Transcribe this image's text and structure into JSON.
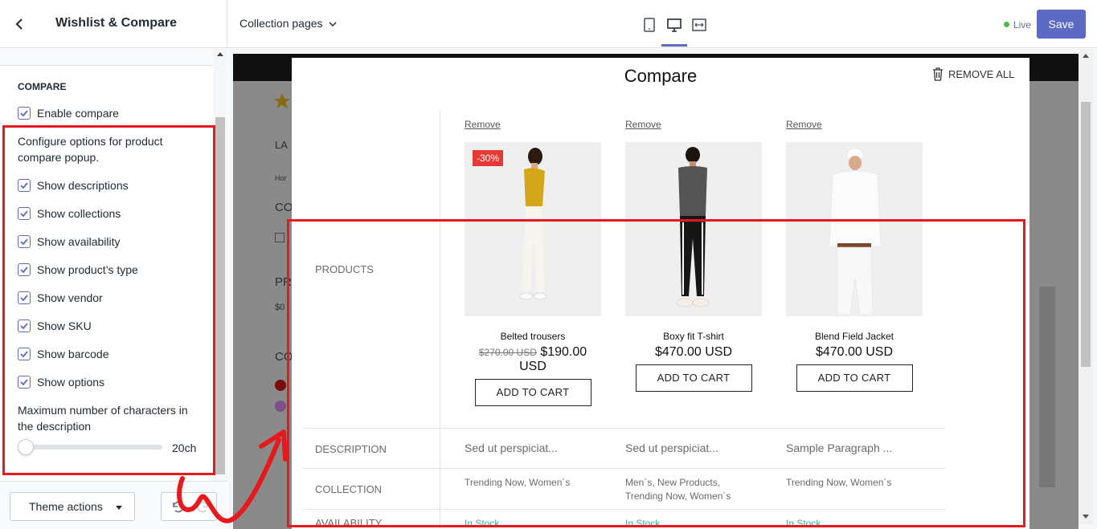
{
  "header": {
    "title": "Wishlist & Compare",
    "page_selector": "Collection pages",
    "status": "Live",
    "save_label": "Save",
    "accent_color": "#5c6ac4",
    "live_color": "#50b83c"
  },
  "sidebar": {
    "section_heading": "COMPARE",
    "enable_compare": {
      "label": "Enable compare",
      "checked": true
    },
    "configure_text": "Configure options for product compare popup.",
    "options": [
      {
        "label": "Show descriptions",
        "checked": true
      },
      {
        "label": "Show collections",
        "checked": true
      },
      {
        "label": "Show availability",
        "checked": true
      },
      {
        "label": "Show product’s type",
        "checked": true
      },
      {
        "label": "Show vendor",
        "checked": true
      },
      {
        "label": "Show SKU",
        "checked": true
      },
      {
        "label": "Show barcode",
        "checked": true
      },
      {
        "label": "Show options",
        "checked": true
      }
    ],
    "max_chars_label": "Maximum number of characters in the description",
    "max_chars_value": "20ch",
    "slider_fraction": 0.0,
    "theme_actions_label": "Theme actions"
  },
  "store_ghost": {
    "nav_text": "LA",
    "breadcrumb": "Hor",
    "heading1": "CO",
    "heading2": "PR",
    "price": "$0",
    "heading3": "CO"
  },
  "compare": {
    "title": "Compare",
    "remove_all_label": "REMOVE ALL",
    "row_labels": {
      "products": "PRODUCTS",
      "description": "DESCRIPTION",
      "collection": "COLLECTION",
      "availability": "AVAILABILITY"
    },
    "products": [
      {
        "remove_label": "Remove",
        "badge": "-30%",
        "name": "Belted trousers",
        "old_price": "$270.00 USD",
        "price": "$190.00 USD",
        "add_to_cart": "ADD TO CART",
        "description": "Sed ut perspiciat...",
        "collection": "Trending Now, Women´s",
        "availability": "In Stock"
      },
      {
        "remove_label": "Remove",
        "badge": "",
        "name": "Boxy fit T-shirt",
        "old_price": "",
        "price": "$470.00 USD",
        "add_to_cart": "ADD TO CART",
        "description": "Sed ut perspiciat...",
        "collection": "Men´s, New Products, Trending Now, Women´s",
        "availability": "In Stock"
      },
      {
        "remove_label": "Remove",
        "badge": "",
        "name": "Blend Field Jacket",
        "old_price": "",
        "price": "$470.00 USD",
        "add_to_cart": "ADD TO CART",
        "description": "Sample Paragraph ...",
        "collection": "Trending Now, Women´s",
        "availability": "In Stock"
      }
    ],
    "stock_color": "#2bb3a0",
    "badge_color": "#e53935"
  },
  "annotations": {
    "highlight_color": "#e8191c"
  }
}
